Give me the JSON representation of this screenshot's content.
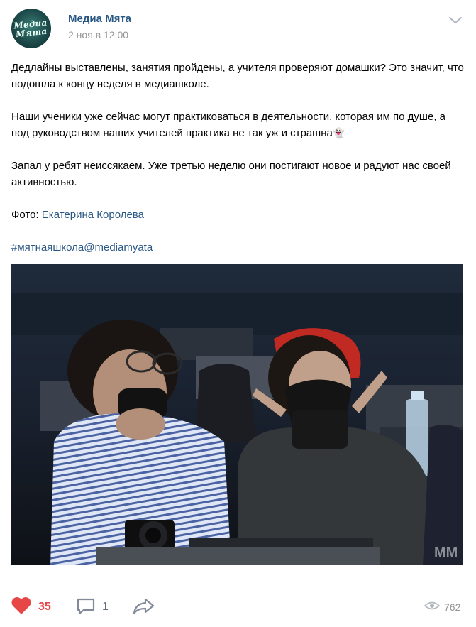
{
  "post": {
    "author": "Медиа Мята",
    "avatar_text_line1": "Медиа",
    "avatar_text_line2": "Мята",
    "date": "2 ноя в 12:00",
    "paragraphs": [
      "Дедлайны выставлены, занятия пройдены, а учителя проверяют домашки? Это значит, что подошла к концу неделя в медиашколе.",
      "Наши ученики уже сейчас могут практиковаться в деятельности, которая им по душе, а под руководством наших учителей практика не так уж и страшна",
      "Запал у ребят неиссякаем. Уже третью неделю они постигают новое и радуют нас своей активностью."
    ],
    "ghost_emoji": "👻",
    "photo_credit_label": "Фото: ",
    "photo_credit_name": "Екатерина Королева",
    "hashtag": "#мятнаяшкола@mediamyata",
    "photo_watermark": "MM"
  },
  "footer": {
    "likes": "35",
    "comments": "1",
    "views": "762"
  },
  "icons": {
    "heart": "heart-icon",
    "comment": "comment-icon",
    "share": "share-icon",
    "eye": "eye-icon",
    "chevron": "chevron-down-icon"
  },
  "colors": {
    "link": "#2a5885",
    "like": "#e64646",
    "muted": "#939393"
  }
}
